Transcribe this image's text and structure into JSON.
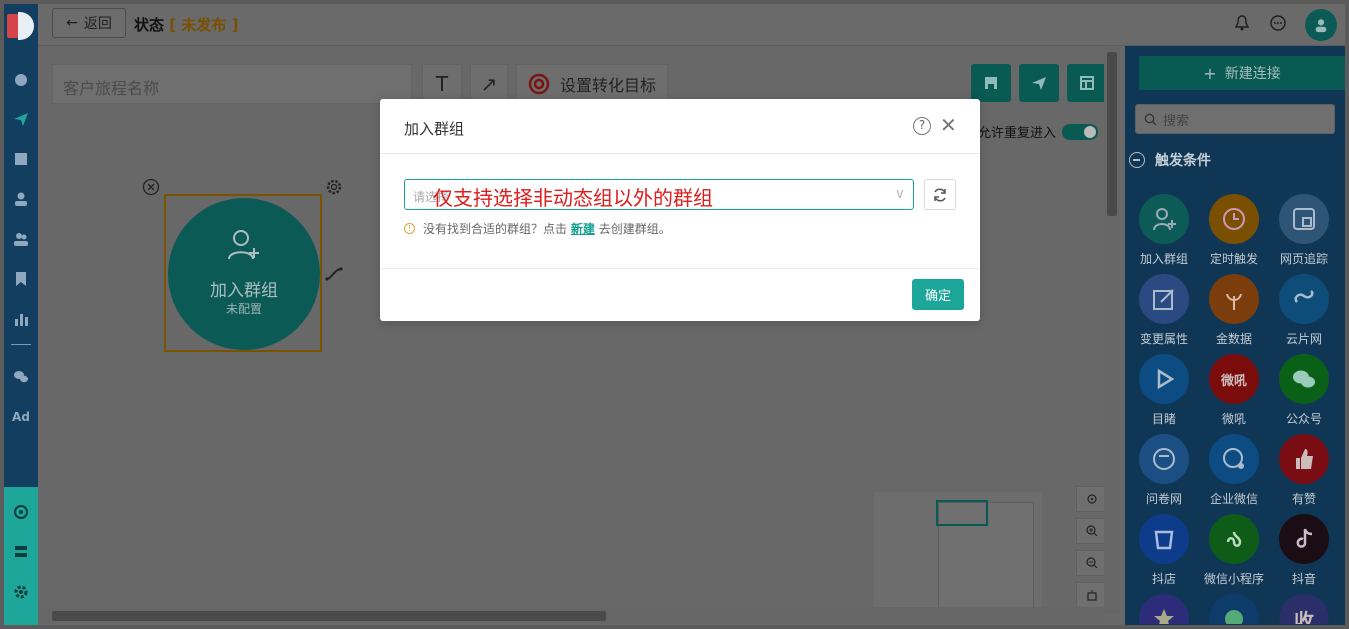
{
  "topbar": {
    "back_label": "返回",
    "status_label": "状态",
    "status_value": "未发布"
  },
  "toolbar": {
    "journey_name_placeholder": "客户旅程名称",
    "text_tool": "T",
    "conversion_goal_label": "设置转化目标"
  },
  "canvas": {
    "allow_reentry_label": "允许重复进入",
    "node": {
      "title": "加入群组",
      "subtitle": "未配置"
    }
  },
  "right_panel": {
    "new_connection_label": "新建连接",
    "search_placeholder": "搜索",
    "section_title": "触发条件",
    "items": [
      {
        "label": "加入群组",
        "icon": "user-plus-icon",
        "color": "#0c5b56"
      },
      {
        "label": "定时触发",
        "icon": "clock-icon",
        "color": "#7a5000"
      },
      {
        "label": "网页追踪",
        "icon": "browser-icon",
        "color": "#2e5576"
      },
      {
        "label": "变更属性",
        "icon": "edit-icon",
        "color": "#2b4a82"
      },
      {
        "label": "金数据",
        "icon": "plant-icon",
        "color": "#7a3d0b"
      },
      {
        "label": "云片网",
        "icon": "link-icon",
        "color": "#0e4d7a"
      },
      {
        "label": "目睹",
        "icon": "play-icon",
        "color": "#0d4c82"
      },
      {
        "label": "微吼",
        "icon": "weihou-icon",
        "color": "#7a0c0c",
        "glyph": "微吼"
      },
      {
        "label": "公众号",
        "icon": "wechat-icon",
        "color": "#0b6018"
      },
      {
        "label": "问卷网",
        "icon": "smile-icon",
        "color": "#1b4f84"
      },
      {
        "label": "企业微信",
        "icon": "wecom-icon",
        "color": "#0d4c82"
      },
      {
        "label": "有赞",
        "icon": "thumb-up-icon",
        "color": "#7a0d14"
      },
      {
        "label": "抖店",
        "icon": "doudian-icon",
        "color": "#0d3c8a"
      },
      {
        "label": "微信小程序",
        "icon": "miniprogram-icon",
        "color": "#0f5b18"
      },
      {
        "label": "抖音",
        "icon": "tiktok-icon",
        "color": "#1b0d14"
      },
      {
        "label": "",
        "icon": "star-icon",
        "color": "#2c2c7a"
      },
      {
        "label": "",
        "icon": "shop-icon",
        "color": "#0d3c6a"
      },
      {
        "label": "",
        "icon": "shou-icon",
        "color": "#2a2f6a",
        "glyph": "收"
      }
    ]
  },
  "dialog": {
    "title": "加入群组",
    "help": "?",
    "select_placeholder": "请选择",
    "select_overlay_text": "仅支持选择非动态组以外的群组",
    "hint_prefix": "没有找到合适的群组？点击",
    "hint_link": "新建",
    "hint_suffix": "去创建群组。",
    "confirm_label": "确定"
  },
  "colors": {
    "teal": "#1ba699",
    "nav_bg": "#123f60",
    "status_orange": "#7a5000",
    "overlay_red": "#e01c1c"
  }
}
